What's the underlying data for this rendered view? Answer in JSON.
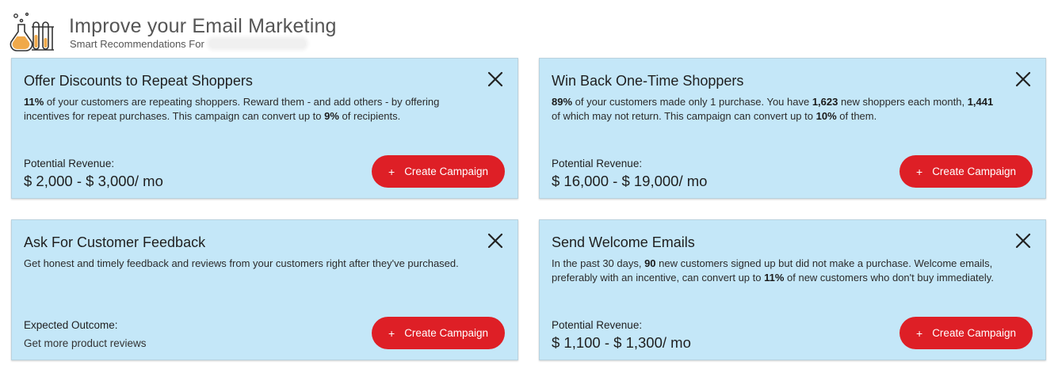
{
  "header": {
    "title": "Improve your Email Marketing",
    "subtitle": "Smart Recommendations For"
  },
  "cards": [
    {
      "title": "Offer Discounts to Repeat Shoppers",
      "desc": [
        {
          "t": "11%",
          "b": true
        },
        {
          "t": " of your customers are repeating shoppers. Reward them - and add others - by offering incentives for repeat purchases. This campaign can convert up to ",
          "b": false
        },
        {
          "t": "9%",
          "b": true
        },
        {
          "t": " of recipients.",
          "b": false
        }
      ],
      "metric_label": "Potential Revenue:",
      "metric_value": "$ 2,000 - $ 3,000/ mo",
      "button_label": "Create Campaign"
    },
    {
      "title": "Win Back One-Time Shoppers",
      "desc": [
        {
          "t": "89%",
          "b": true
        },
        {
          "t": " of your customers made only 1 purchase. You have ",
          "b": false
        },
        {
          "t": "1,623",
          "b": true
        },
        {
          "t": " new shoppers each month, ",
          "b": false
        },
        {
          "t": "1,441",
          "b": true
        },
        {
          "t": " of which may not return. This campaign can convert up to ",
          "b": false
        },
        {
          "t": "10%",
          "b": true
        },
        {
          "t": " of them.",
          "b": false
        }
      ],
      "metric_label": "Potential Revenue:",
      "metric_value": "$ 16,000 - $ 19,000/ mo",
      "button_label": "Create Campaign"
    },
    {
      "title": "Ask For Customer Feedback",
      "desc": [
        {
          "t": "Get honest and timely feedback and reviews from your customers right after they've purchased.",
          "b": false
        }
      ],
      "metric_label": "Expected Outcome:",
      "metric_value": "Get more product reviews",
      "button_label": "Create Campaign"
    },
    {
      "title": "Send Welcome Emails",
      "desc": [
        {
          "t": "In the past 30 days, ",
          "b": false
        },
        {
          "t": "90",
          "b": true
        },
        {
          "t": " new customers signed up but did not make a purchase. Welcome emails, preferably with an incentive, can convert up to ",
          "b": false
        },
        {
          "t": "11%",
          "b": true
        },
        {
          "t": " of new customers who don't buy immediately.",
          "b": false
        }
      ],
      "metric_label": "Potential Revenue:",
      "metric_value": "$ 1,100 - $ 1,300/ mo",
      "button_label": "Create Campaign"
    }
  ],
  "icons": {
    "logo": "lab-flasks-icon",
    "close": "close-icon",
    "plus": "plus-icon",
    "plus_glyph": "+"
  },
  "colors": {
    "card_bg": "#c4e7f8",
    "button": "#de1f26",
    "logo_accent": "#f0a94a"
  }
}
